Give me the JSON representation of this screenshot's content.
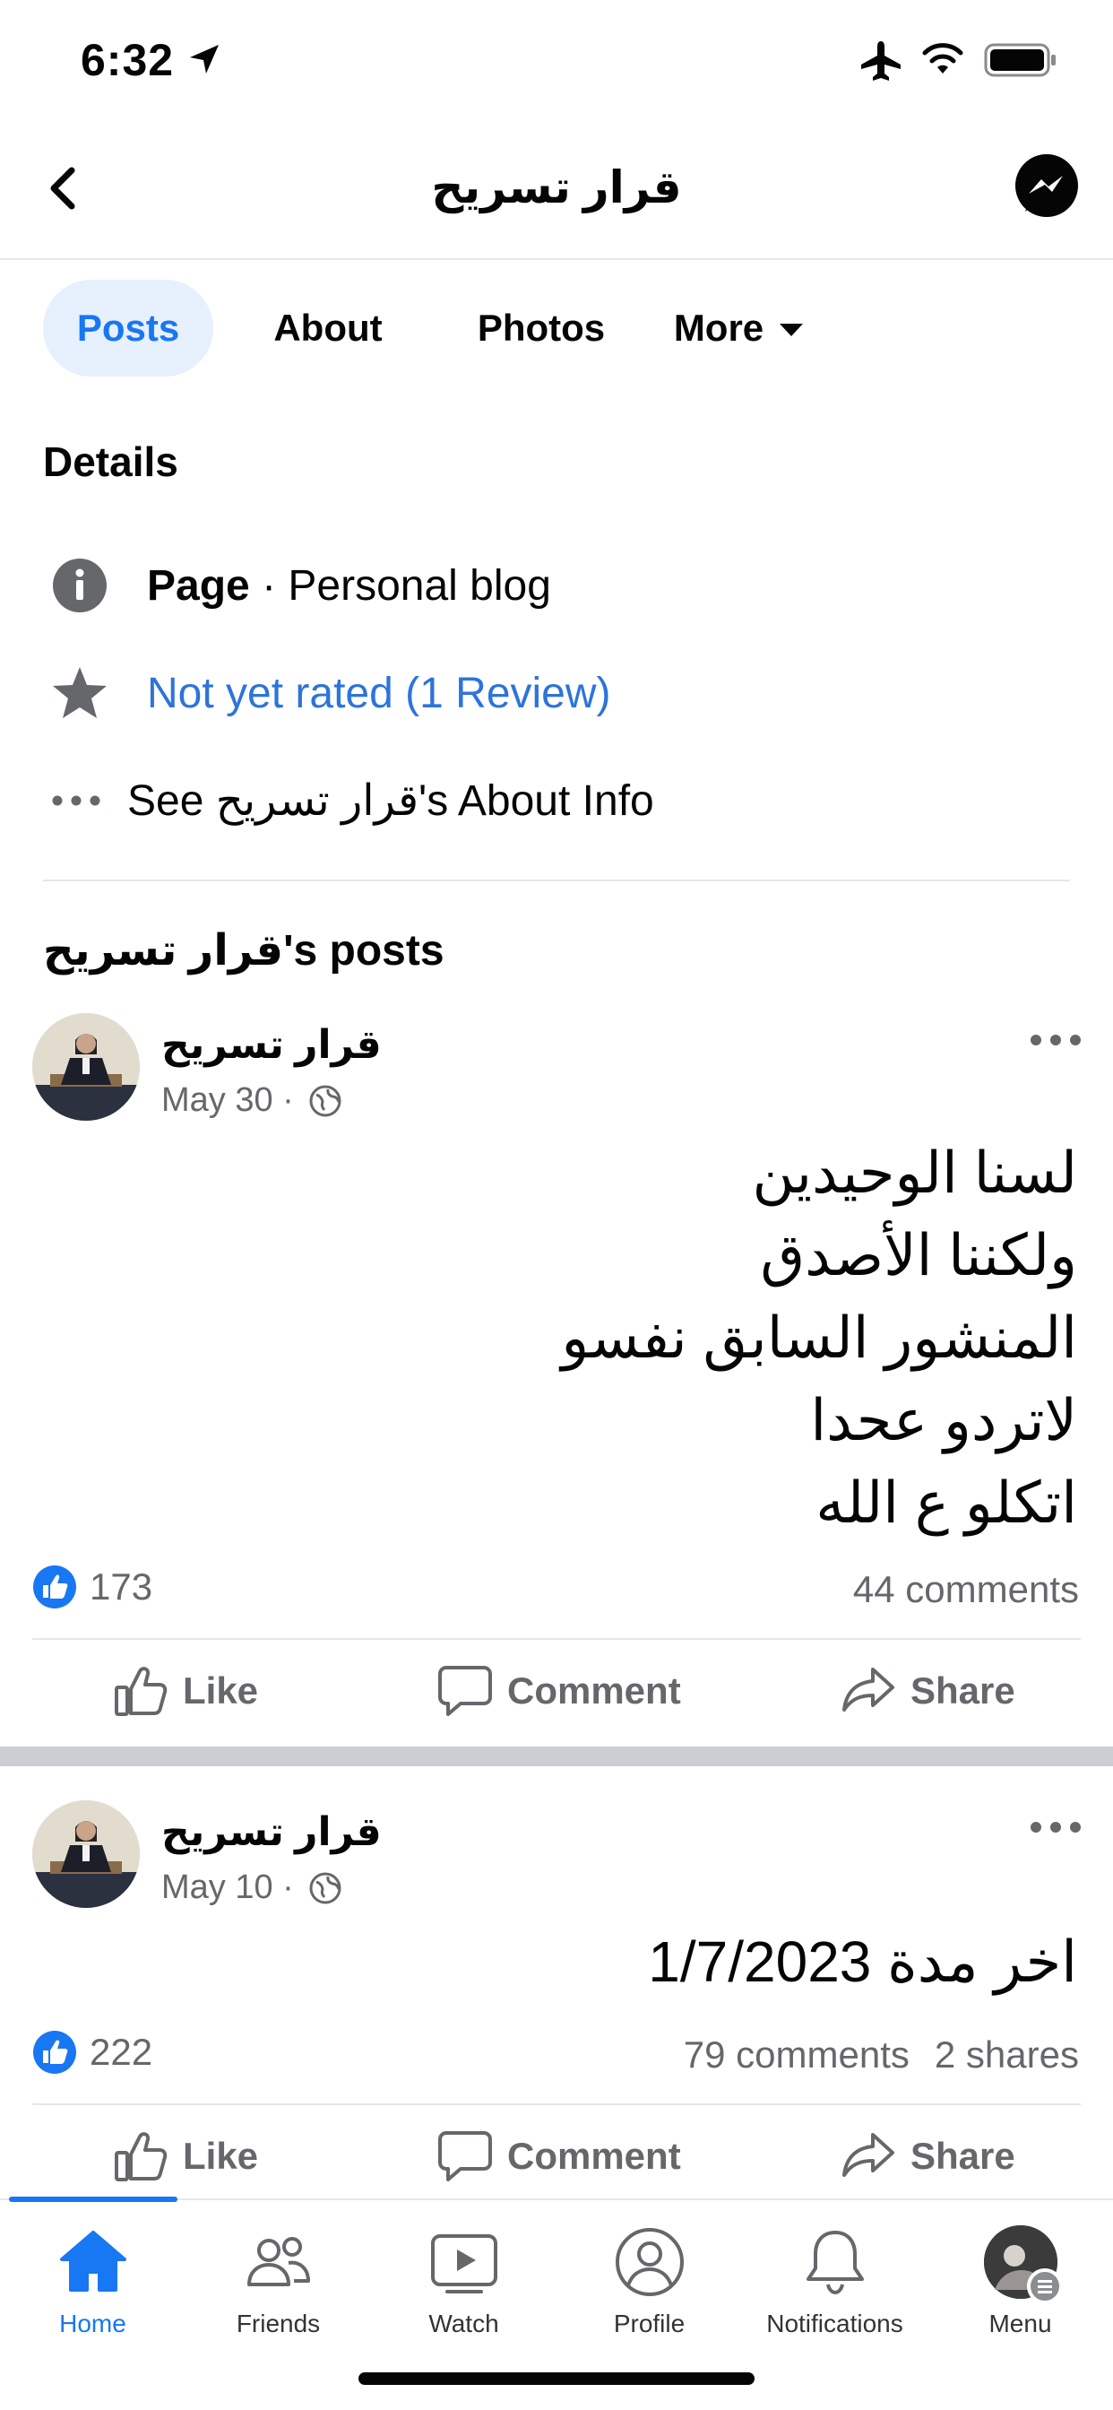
{
  "status_bar": {
    "time": "6:32"
  },
  "nav": {
    "title": "قرار تسريح"
  },
  "tabs": [
    {
      "label": "Posts"
    },
    {
      "label": "About"
    },
    {
      "label": "Photos"
    },
    {
      "label": "More"
    }
  ],
  "details": {
    "heading": "Details",
    "page_type_label": "Page",
    "page_type_separator": " · ",
    "page_type_value": "Personal blog",
    "rating": "Not yet rated (1 Review)",
    "about_link": "See قرار تسريح's About Info"
  },
  "posts_heading": "قرار تسريح's posts",
  "posts": [
    {
      "author": "قرار تسريح",
      "date": "May 30 ·",
      "text": "لسنا الوحيدين\nولكننا الأصدق\nالمنشور السابق نفسو\nلاتردو عحدا\nاتكلو ع الله",
      "likes": "173",
      "comments": "44 comments",
      "shares": ""
    },
    {
      "author": "قرار تسريح",
      "date": "May 10 ·",
      "text": "اخر مدة 1/7/2023",
      "likes": "222",
      "comments": "79 comments",
      "shares": "2 shares"
    }
  ],
  "actions": {
    "like": "Like",
    "comment": "Comment",
    "share": "Share"
  },
  "bottom_nav": [
    {
      "label": "Home",
      "icon": "home-icon"
    },
    {
      "label": "Friends",
      "icon": "friends-icon"
    },
    {
      "label": "Watch",
      "icon": "watch-icon"
    },
    {
      "label": "Profile",
      "icon": "profile-icon"
    },
    {
      "label": "Notifications",
      "icon": "bell-icon"
    },
    {
      "label": "Menu",
      "icon": "menu-avatar"
    }
  ],
  "colors": {
    "accent": "#1877f2",
    "link": "#2d74da",
    "muted": "#65676b"
  }
}
